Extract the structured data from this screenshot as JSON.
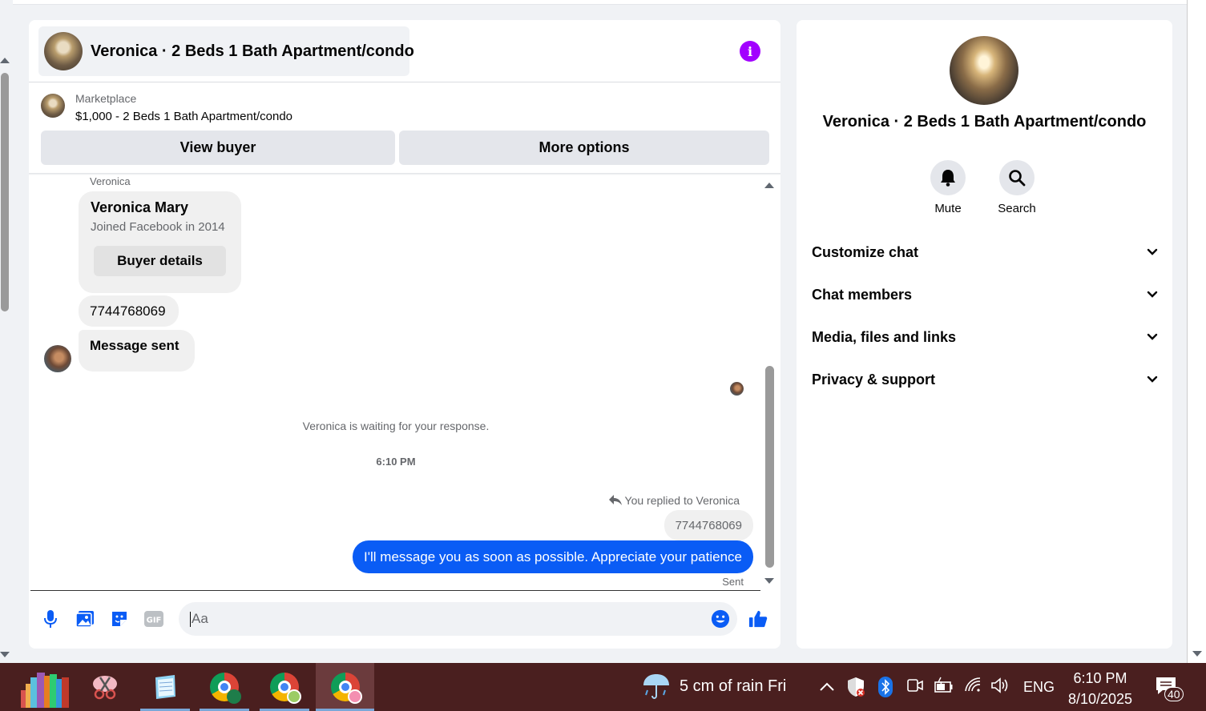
{
  "chat": {
    "title": "Veronica · 2 Beds 1 Bath Apartment/condo",
    "marketplace_label": "Marketplace",
    "listing": "$1,000 - 2 Beds 1 Bath Apartment/condo",
    "view_buyer": "View buyer",
    "more_options": "More options"
  },
  "messages": {
    "sender_name": "Veronica",
    "card_name": "Veronica Mary",
    "card_sub": "Joined Facebook in 2014",
    "card_button": "Buyer details",
    "phone": "7744768069",
    "message_sent": "Message sent",
    "waiting": "Veronica is waiting for your response.",
    "time": "6:10 PM",
    "replied_to": "You replied to Veronica",
    "quoted": "7744768069",
    "my_message": "I'll message you as soon as possible. Appreciate your patience",
    "status": "Sent"
  },
  "composer": {
    "placeholder": "Aa"
  },
  "info": {
    "title": "Veronica · 2 Beds 1 Bath Apartment/condo",
    "mute": "Mute",
    "search": "Search",
    "sections": [
      "Customize chat",
      "Chat members",
      "Media, files and links",
      "Privacy & support"
    ]
  },
  "taskbar": {
    "weather": "5 cm of rain Fri",
    "language": "ENG",
    "time": "6:10 PM",
    "date": "8/10/2025",
    "notifications": "40"
  },
  "colors": {
    "accent": "#0a5cf5",
    "info_icon": "#a200ff",
    "taskbar": "#4a1f1f"
  }
}
